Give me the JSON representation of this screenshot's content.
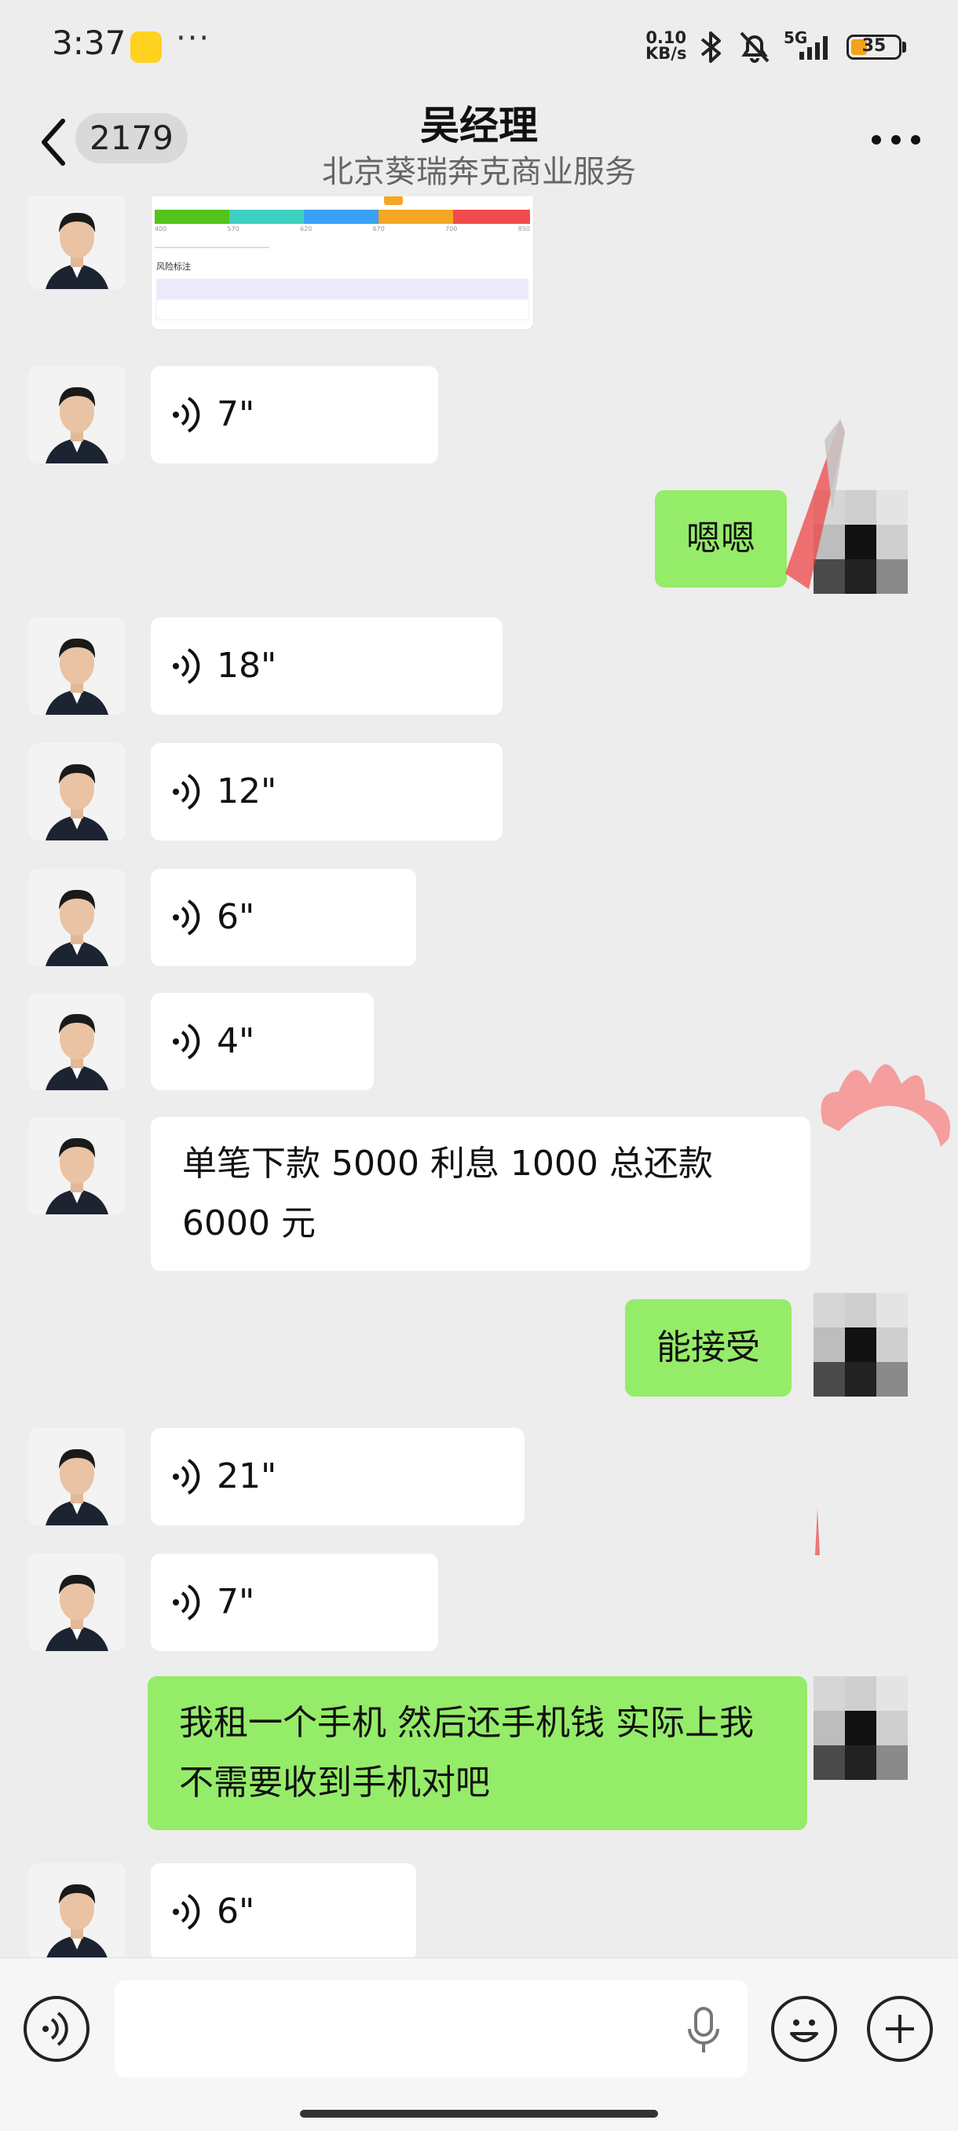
{
  "status_bar": {
    "time": "3:37",
    "dots": "···",
    "net_speed_value": "0.10",
    "net_speed_unit": "KB/s",
    "network": "5G",
    "battery_level": "35"
  },
  "header": {
    "unread_count": "2179",
    "title": "吴经理",
    "subtitle": "北京葵瑞奔克商业服务"
  },
  "messages": [
    {
      "type": "image",
      "side": "in"
    },
    {
      "type": "voice",
      "side": "in",
      "duration": "7\""
    },
    {
      "type": "text",
      "side": "out",
      "text": "嗯嗯"
    },
    {
      "type": "voice",
      "side": "in",
      "duration": "18\""
    },
    {
      "type": "voice",
      "side": "in",
      "duration": "12\""
    },
    {
      "type": "voice",
      "side": "in",
      "duration": "6\""
    },
    {
      "type": "voice",
      "side": "in",
      "duration": "4\""
    },
    {
      "type": "text",
      "side": "in",
      "text": "单笔下款 5000 利息 1000 总还款 6000 元"
    },
    {
      "type": "text",
      "side": "out",
      "text": "能接受"
    },
    {
      "type": "voice",
      "side": "in",
      "duration": "21\""
    },
    {
      "type": "voice",
      "side": "in",
      "duration": "7\""
    },
    {
      "type": "text",
      "side": "out",
      "text": "我租一个手机 然后还手机钱  实际上我不需要收到手机对吧"
    },
    {
      "type": "voice",
      "side": "in",
      "duration": "6\""
    }
  ],
  "report_card": {
    "section_title": "风险标注",
    "scale_ticks": [
      "400",
      "570",
      "620",
      "670",
      "700",
      "850"
    ],
    "band_colors": [
      "#52c41a",
      "#3fcfc0",
      "#3aa0f5",
      "#f5a623",
      "#f04b4b"
    ]
  },
  "input_bar": {
    "placeholder": ""
  },
  "colors": {
    "background": "#ededed",
    "outgoing_bubble": "#95ec69",
    "incoming_bubble": "#ffffff"
  }
}
